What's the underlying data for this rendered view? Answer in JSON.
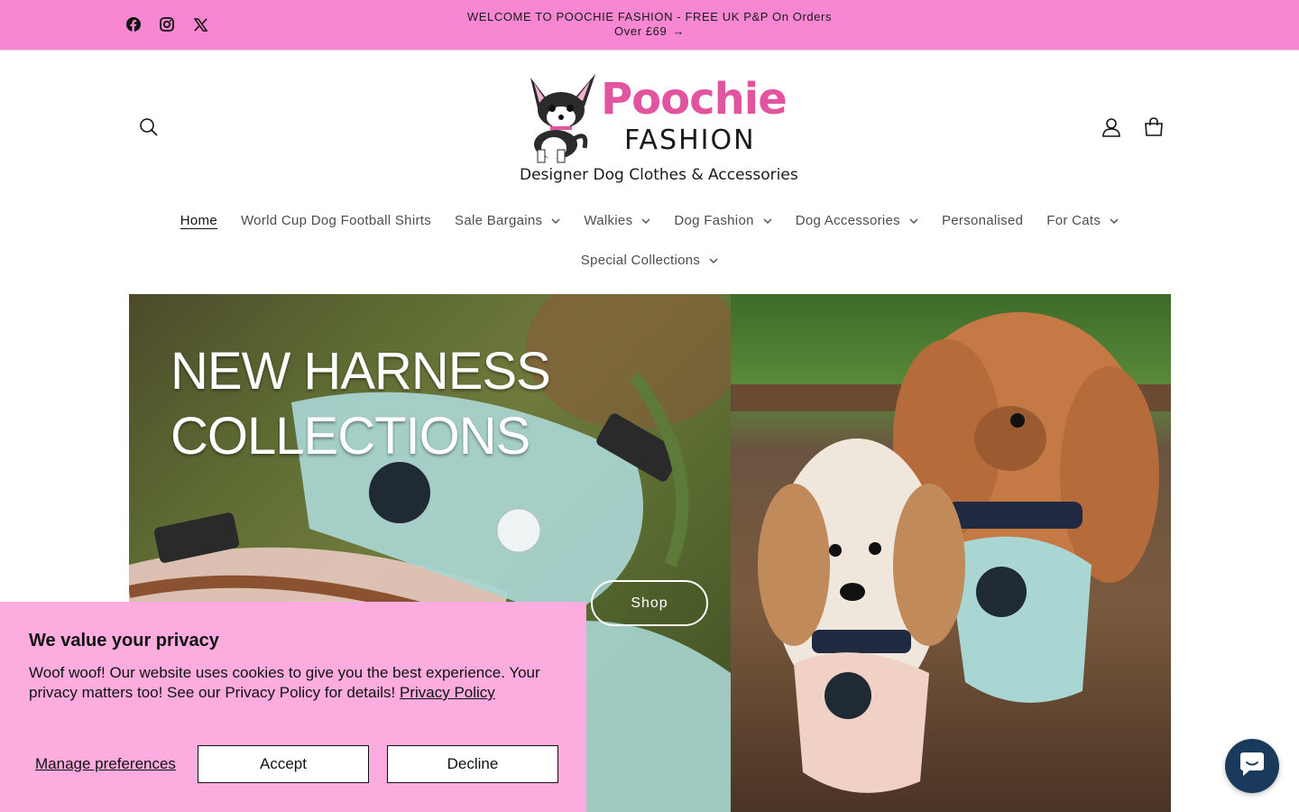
{
  "announcement": {
    "line1": "WELCOME TO POOCHIE FASHION - FREE UK P&P On Orders",
    "line2": "Over £69",
    "arrow": "→"
  },
  "socials": [
    {
      "name": "facebook-icon"
    },
    {
      "name": "instagram-icon"
    },
    {
      "name": "x-icon"
    }
  ],
  "logo": {
    "title": "Poochie",
    "subtitle": "FASHION",
    "tagline": "Designer Dog Clothes & Accessories"
  },
  "nav": {
    "items": [
      {
        "label": "Home",
        "active": true,
        "dropdown": false
      },
      {
        "label": "World Cup Dog Football Shirts",
        "dropdown": false
      },
      {
        "label": "Sale Bargains",
        "dropdown": true
      },
      {
        "label": "Walkies",
        "dropdown": true
      },
      {
        "label": "Dog Fashion",
        "dropdown": true
      },
      {
        "label": "Dog Accessories",
        "dropdown": true
      },
      {
        "label": "Personalised",
        "dropdown": false
      },
      {
        "label": "For Cats",
        "dropdown": true
      }
    ],
    "second_row": [
      {
        "label": "Special Collections",
        "dropdown": true
      }
    ]
  },
  "hero": {
    "title_line1": "NEW HARNESS",
    "title_line2": "COLLECTIONS",
    "button_label": "Shop"
  },
  "cookie": {
    "heading": "We value your privacy",
    "body": "Woof woof! Our website uses cookies to give you the best experience. Your privacy matters too! See our Privacy Policy for details! ",
    "link_label": "Privacy Policy",
    "manage_label": "Manage preferences",
    "accept_label": "Accept",
    "decline_label": "Decline"
  },
  "colors": {
    "announcement_bg": "#f787d2",
    "cookie_bg": "#fdacdf",
    "brand_pink": "#e1549f",
    "chat_bg": "#1a3a5c"
  }
}
